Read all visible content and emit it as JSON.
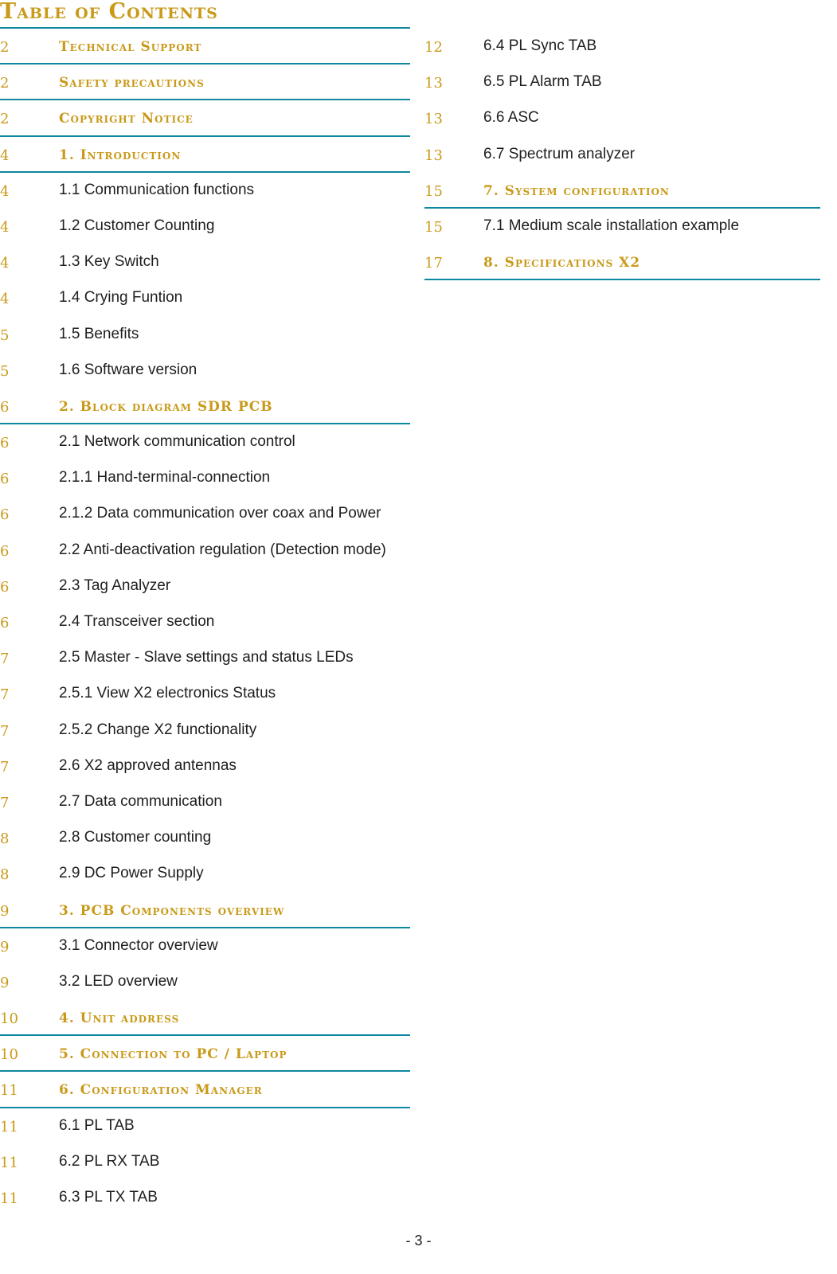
{
  "title": "Table of Contents",
  "left_entries": [
    {
      "page": "2",
      "label": "Technical Support",
      "level": "section"
    },
    {
      "page": "2",
      "label": "Safety precautions",
      "level": "section"
    },
    {
      "page": "2",
      "label": "Copyright Notice",
      "level": "section"
    },
    {
      "page": "4",
      "label": "1. Introduction",
      "level": "section"
    },
    {
      "page": "4",
      "label": "1.1 Communication functions",
      "level": "sub"
    },
    {
      "page": "4",
      "label": "1.2 Customer Counting",
      "level": "sub"
    },
    {
      "page": "4",
      "label": "1.3 Key Switch",
      "level": "sub"
    },
    {
      "page": "4",
      "label": "1.4 Crying Funtion",
      "level": "sub"
    },
    {
      "page": "5",
      "label": "1.5 Benefits",
      "level": "sub"
    },
    {
      "page": "5",
      "label": "1.6 Software version",
      "level": "sub"
    },
    {
      "page": "6",
      "label": "2. Block diagram SDR  PCB",
      "level": "section"
    },
    {
      "page": "6",
      "label": "2.1 Network communication control",
      "level": "sub"
    },
    {
      "page": "6",
      "label": "2.1.1 Hand-terminal-connection",
      "level": "sub"
    },
    {
      "page": "6",
      "label": "2.1.2 Data communication over coax and Power",
      "level": "sub"
    },
    {
      "page": "6",
      "label": "2.2 Anti-deactivation regulation (Detection mode)",
      "level": "sub"
    },
    {
      "page": "6",
      "label": "2.3 Tag Analyzer",
      "level": "sub"
    },
    {
      "page": "6",
      "label": "2.4 Transceiver section",
      "level": "sub"
    },
    {
      "page": "7",
      "label": "2.5 Master - Slave settings and status LEDs",
      "level": "sub"
    },
    {
      "page": "7",
      "label": "2.5.1 View X2 electronics Status",
      "level": "sub"
    },
    {
      "page": "7",
      "label": "2.5.2 Change X2 functionality",
      "level": "sub"
    },
    {
      "page": "7",
      "label": "2.6 X2 approved antennas",
      "level": "sub"
    },
    {
      "page": "7",
      "label": "2.7 Data communication",
      "level": "sub"
    },
    {
      "page": "8",
      "label": "2.8 Customer counting",
      "level": "sub"
    },
    {
      "page": "8",
      "label": "2.9 DC Power Supply",
      "level": "sub"
    },
    {
      "page": "9",
      "label": "3. PCB Components overview",
      "level": "section"
    },
    {
      "page": "9",
      "label": "3.1 Connector overview",
      "level": "sub"
    },
    {
      "page": "9",
      "label": "3.2 LED overview",
      "level": "sub"
    },
    {
      "page": "10",
      "label": "4. Unit address",
      "level": "section"
    },
    {
      "page": "10",
      "label": "5. Connection to PC / Laptop",
      "level": "section"
    },
    {
      "page": "11",
      "label": "6. Configuration Manager",
      "level": "section"
    },
    {
      "page": "11",
      "label": "6.1 PL TAB",
      "level": "sub"
    },
    {
      "page": "11",
      "label": "6.2 PL RX TAB",
      "level": "sub"
    },
    {
      "page": "11",
      "label": "6.3 PL TX TAB",
      "level": "sub"
    }
  ],
  "right_entries": [
    {
      "page": "12",
      "label": "6.4 PL Sync TAB",
      "level": "sub"
    },
    {
      "page": "13",
      "label": "6.5 PL Alarm TAB",
      "level": "sub"
    },
    {
      "page": "13",
      "label": "6.6 ASC",
      "level": "sub"
    },
    {
      "page": "13",
      "label": "6.7 Spectrum analyzer",
      "level": "sub"
    },
    {
      "page": "15",
      "label": "7. System configuration",
      "level": "section"
    },
    {
      "page": "15",
      "label": "7.1 Medium scale installation example",
      "level": "sub"
    },
    {
      "page": "17",
      "label": "8. Specifications X2",
      "level": "section"
    }
  ],
  "footer": "- 3 -"
}
